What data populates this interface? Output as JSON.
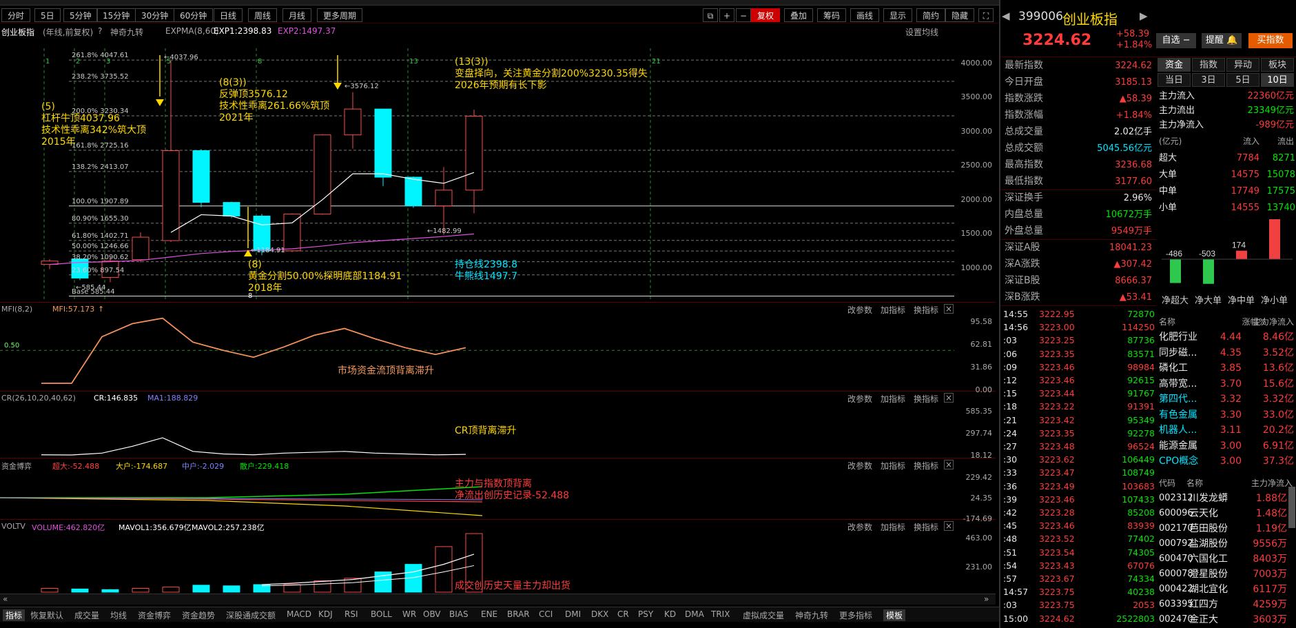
{
  "toolbar": {
    "items": [
      "分时",
      "5日",
      "5分钟",
      "15分钟",
      "30分钟",
      "60分钟",
      "日线",
      "周线",
      "月线",
      "更多周期"
    ],
    "right": [
      "复权",
      "叠加",
      "筹码",
      "画线",
      "显示",
      "简约",
      "隐藏"
    ]
  },
  "header": {
    "name": "创业板指",
    "params": "(年线,前复权)",
    "indicator": "神奇九转",
    "ema_params": "EXPMA(8,60)",
    "exp1": "EXP1:2398.83",
    "exp2": "EXP2:1497.37",
    "settings": "设置均线"
  },
  "main": {
    "ylabels": [
      "4000.00",
      "3500.00",
      "3000.00",
      "2500.00",
      "2000.00",
      "1500.00",
      "1000.00"
    ],
    "fib": [
      {
        "t": "261.8% 4047.61"
      },
      {
        "t": "238.2% 3735.52"
      },
      {
        "t": "200.0% 3230.34"
      },
      {
        "t": "161.8% 2725.16"
      },
      {
        "t": "138.2% 2413.07"
      },
      {
        "t": "100.0% 1907.89"
      },
      {
        "t": "80.90% 1655.30"
      },
      {
        "t": "61.80% 1402.71"
      },
      {
        "t": "50.00% 1246.66"
      },
      {
        "t": "38.20% 1090.62"
      },
      {
        "t": "23.60% 897.54"
      },
      {
        "t": "Base 585.44"
      }
    ],
    "counters": [
      "1",
      "2",
      "3",
      "5",
      "8",
      "13",
      "21"
    ],
    "price_labels": [
      "4037.96",
      "3576.12",
      "1184.91",
      "1482.99",
      "585.44"
    ],
    "ann1": [
      "(5)",
      "杠杆牛顶4037.96",
      "技术性乖离342%筑大顶",
      "2015年"
    ],
    "ann2": [
      "(8(3))",
      "反弹顶3576.12",
      "技术性乖离261.66%筑顶",
      "2021年"
    ],
    "ann3": [
      "(13(3))",
      "变盘择向，关注黄金分割200%3230.35得失",
      "2026年预期有长下影"
    ],
    "ann4": [
      "(8)",
      "黄金分割50.00%探明底部1184.91",
      "2018年"
    ],
    "ann5": [
      "持仓线2398.8",
      "牛熊线1497.7"
    ],
    "low_mark": "8"
  },
  "chart_data": [
    {
      "type": "candlestick",
      "title": "创业板指 年线",
      "ylim": [
        500,
        4100
      ],
      "candles": [
        {
          "open": 1050,
          "close": 1100,
          "high": 1130,
          "low": 980,
          "up": true
        },
        {
          "open": 1130,
          "close": 850,
          "high": 1140,
          "low": 820,
          "up": false
        },
        {
          "open": 860,
          "close": 1100,
          "high": 1160,
          "low": 790,
          "up": true
        },
        {
          "open": 1120,
          "close": 1450,
          "high": 1520,
          "low": 1080,
          "up": true
        },
        {
          "open": 1400,
          "close": 2720,
          "high": 4037.96,
          "low": 1380,
          "up": true
        },
        {
          "open": 2720,
          "close": 1960,
          "high": 2740,
          "low": 1890,
          "up": false
        },
        {
          "open": 1960,
          "close": 1760,
          "high": 1970,
          "low": 1730,
          "up": false
        },
        {
          "open": 1760,
          "close": 1250,
          "high": 1790,
          "low": 1184.91,
          "up": false
        },
        {
          "open": 1250,
          "close": 1790,
          "high": 1800,
          "low": 1230,
          "up": true
        },
        {
          "open": 1790,
          "close": 2950,
          "high": 2960,
          "low": 1780,
          "up": true
        },
        {
          "open": 2950,
          "close": 3330,
          "high": 3576.12,
          "low": 2750,
          "up": true
        },
        {
          "open": 3330,
          "close": 2330,
          "high": 3330,
          "low": 2200,
          "up": false
        },
        {
          "open": 2330,
          "close": 1910,
          "high": 2340,
          "low": 1880,
          "up": false
        },
        {
          "open": 1910,
          "close": 2140,
          "high": 2480,
          "low": 1482.99,
          "up": true
        },
        {
          "open": 2140,
          "close": 3224.62,
          "high": 3320,
          "low": 1800,
          "up": true
        }
      ],
      "exp1": [
        null,
        null,
        null,
        null,
        1520,
        1780,
        1760,
        1630,
        1660,
        2000,
        2380,
        2380,
        2300,
        2240,
        2398.83
      ],
      "exp2": [
        1050,
        1080,
        1090,
        1110,
        1160,
        1210,
        1240,
        1260,
        1280,
        1320,
        1370,
        1400,
        1430,
        1460,
        1497.37
      ]
    },
    {
      "type": "line",
      "name": "MFI(8,2)",
      "value_label": "MFI:57.173",
      "ylim": [
        0,
        95.58
      ],
      "ylabels": [
        "95.58",
        "62.81",
        "31.86",
        "0.00"
      ],
      "level_label": "0.50",
      "values": [
        0,
        0,
        68,
        87,
        95,
        60,
        48,
        38,
        53,
        70,
        80,
        65,
        52,
        42,
        52
      ],
      "annotation": "市场资金流顶背离滞升"
    },
    {
      "type": "line",
      "name": "CR(26,10,20,40,62)",
      "value_label": "CR:146.835",
      "ma_label": "MA1:188.829",
      "ylim": [
        18.12,
        585.35
      ],
      "ylabels": [
        "585.35",
        "297.74",
        "18.12"
      ],
      "values": [
        20,
        18,
        40,
        120,
        220,
        60,
        30,
        20,
        40,
        50,
        60,
        40,
        30,
        20,
        25
      ],
      "annotation": "CR顶背离滞升"
    },
    {
      "type": "line",
      "name": "资金博弈",
      "labels": [
        "超大:-52.488",
        "大户:-174.687",
        "中户:-2.029",
        "散户:229.418"
      ],
      "ylim": [
        -174.69,
        229.42
      ],
      "ylabels": [
        "229.42",
        "24.35",
        "-174.69"
      ],
      "annotation": [
        "主力与指数顶背离",
        "净流出创历史记录-52.488"
      ]
    },
    {
      "type": "bar",
      "name": "VOLTV",
      "labels": [
        "VOLUME:462.820亿",
        "MAVOL1:356.679亿",
        "MAVOL2:257.238亿"
      ],
      "ylim": [
        0,
        463
      ],
      "ylabels": [
        "463.00",
        "231.00"
      ],
      "values": [
        30,
        25,
        20,
        30,
        40,
        55,
        50,
        60,
        60,
        90,
        110,
        160,
        220,
        360,
        462.82
      ],
      "up": [
        true,
        false,
        false,
        true,
        true,
        false,
        false,
        false,
        true,
        true,
        true,
        false,
        false,
        true,
        true
      ],
      "annotation": "成交创历史天量主力却出货"
    }
  ],
  "panel_btns": [
    "改参数",
    "加指标",
    "换指标"
  ],
  "bottom_tabs": [
    "指标",
    "恢复默认",
    "成交量",
    "均线",
    "资金博弈",
    "资金趋势",
    "深股通成交额",
    "MACD",
    "KDJ",
    "RSI",
    "BOLL",
    "WR",
    "OBV",
    "BIAS",
    "ENE",
    "BRAR",
    "CCI",
    "DMI",
    "DKX",
    "CR",
    "PSY",
    "KD",
    "DMA",
    "TRIX",
    "虚拟成交量",
    "神奇九转",
    "更多指标",
    "模板"
  ],
  "side": {
    "code": "399006",
    "name": "创业板指",
    "price": "3224.62",
    "chg": "+58.39",
    "pct": "+1.84%",
    "btn_watch": "自选",
    "btn_alert": "提醒",
    "btn_buy": "买指数",
    "stats": [
      [
        "最新指数",
        "3224.62",
        "red"
      ],
      [
        "今日开盘",
        "3185.13",
        "red"
      ],
      [
        "指数涨跌",
        "▲58.39",
        "red"
      ],
      [
        "指数涨幅",
        "+1.84%",
        "red"
      ],
      [
        "总成交量",
        "2.02亿手",
        "white"
      ],
      [
        "总成交额",
        "5045.56亿元",
        "cyan"
      ],
      [
        "最高指数",
        "3236.68",
        "red"
      ],
      [
        "最低指数",
        "3177.60",
        "red"
      ],
      [
        "深证换手",
        "2.96%",
        "white"
      ],
      [
        "内盘总量",
        "10672万手",
        "green"
      ],
      [
        "外盘总量",
        "9549万手",
        "red"
      ],
      [
        "深证A股",
        "18041.23",
        "red"
      ],
      [
        "深A涨跌",
        "▲307.42",
        "red"
      ],
      [
        "深证B股",
        "8666.37",
        "red"
      ],
      [
        "深B涨跌",
        "▲53.41",
        "red"
      ]
    ],
    "tabs1": [
      "资金",
      "指数",
      "异动",
      "板块"
    ],
    "tabs2": [
      "当日",
      "3日",
      "5日",
      "10日"
    ],
    "flows": [
      [
        "主力流入",
        "22360亿元"
      ],
      [
        "主力流出",
        "23349亿元"
      ],
      [
        "主力净流入",
        "-989亿元"
      ]
    ],
    "flow_hdr": [
      "(亿元)",
      "流入",
      "流出"
    ],
    "flow_rows": [
      [
        "超大",
        "7784",
        "8271"
      ],
      [
        "大单",
        "14575",
        "15078"
      ],
      [
        "中单",
        "17749",
        "17575"
      ],
      [
        "小单",
        "14555",
        "13740"
      ]
    ],
    "net_bars": [
      {
        "label": "净超大",
        "v": -486
      },
      {
        "label": "净大单",
        "v": -503
      },
      {
        "label": "净中单",
        "v": 174
      },
      {
        "label": "净小单",
        "v": 816
      }
    ],
    "ticks": [
      [
        "14:55",
        "3222.95",
        "72870"
      ],
      [
        "14:56",
        "3223.00",
        "114250"
      ],
      [
        ":03",
        "3223.25",
        "87736"
      ],
      [
        ":06",
        "3223.35",
        "83571"
      ],
      [
        ":09",
        "3223.46",
        "98984"
      ],
      [
        ":12",
        "3223.46",
        "92615"
      ],
      [
        ":15",
        "3223.44",
        "91767"
      ],
      [
        ":18",
        "3223.22",
        "91391"
      ],
      [
        ":21",
        "3223.42",
        "95349"
      ],
      [
        ":24",
        "3223.35",
        "92278"
      ],
      [
        ":27",
        "3223.48",
        "96524"
      ],
      [
        ":30",
        "3223.62",
        "106449"
      ],
      [
        ":33",
        "3223.47",
        "108749"
      ],
      [
        ":36",
        "3223.49",
        "103683"
      ],
      [
        ":39",
        "3223.46",
        "107433"
      ],
      [
        ":42",
        "3223.28",
        "85208"
      ],
      [
        ":45",
        "3223.46",
        "83939"
      ],
      [
        ":48",
        "3223.52",
        "77402"
      ],
      [
        ":51",
        "3223.54",
        "74305"
      ],
      [
        ":54",
        "3223.43",
        "67076"
      ],
      [
        ":57",
        "3223.67",
        "74334"
      ],
      [
        "14:57",
        "3223.75",
        "40238"
      ],
      [
        ":03",
        "3223.75",
        "2053"
      ],
      [
        "15:00",
        "3224.62",
        "2522803"
      ]
    ],
    "sector_hdr": [
      "名称",
      "涨幅%",
      "主力净流入"
    ],
    "sectors": [
      [
        "化肥行业",
        "4.44",
        "8.46亿",
        "white"
      ],
      [
        "同步磁...",
        "4.35",
        "3.52亿",
        "white"
      ],
      [
        "磷化工",
        "3.85",
        "13.6亿",
        "white"
      ],
      [
        "高带宽...",
        "3.70",
        "15.6亿",
        "white"
      ],
      [
        "第四代...",
        "3.32",
        "3.32亿",
        "cyan"
      ],
      [
        "有色金属",
        "3.30",
        "33.0亿",
        "cyan"
      ],
      [
        "机器人...",
        "3.11",
        "20.2亿",
        "cyan"
      ],
      [
        "能源金属",
        "3.00",
        "6.91亿",
        "white"
      ],
      [
        "CPO概念",
        "3.00",
        "37.3亿",
        "cyan"
      ]
    ],
    "stock_hdr": [
      "代码",
      "名称",
      "主力净流入"
    ],
    "stocks": [
      [
        "002312",
        "川发龙蟒",
        "1.88亿"
      ],
      [
        "600096",
        "云天化",
        "1.48亿"
      ],
      [
        "002170",
        "芭田股份",
        "1.19亿"
      ],
      [
        "000792",
        "盐湖股份",
        "9556万"
      ],
      [
        "600470",
        "六国化工",
        "8403万"
      ],
      [
        "600078",
        "澄星股份",
        "7003万"
      ],
      [
        "000422",
        "湖北宜化",
        "6117万"
      ],
      [
        "603395",
        "红四方",
        "4259万"
      ],
      [
        "002470",
        "金正大",
        "3603万"
      ]
    ]
  }
}
